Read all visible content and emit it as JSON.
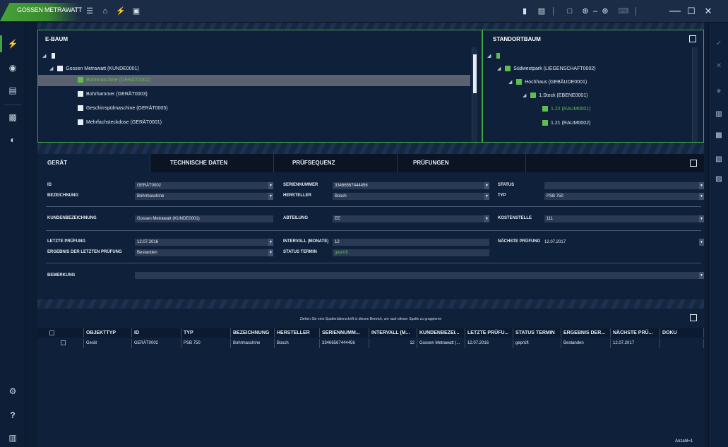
{
  "app": {
    "logo_text": "Gossen Metrawatt"
  },
  "titlebar": {
    "icons": [
      "menu-icon",
      "home-icon",
      "lightning-icon",
      "monitor-icon",
      "device-icon",
      "document-icon",
      "window-icon",
      "zoom-out-icon",
      "zoom-in-icon",
      "keyboard-icon"
    ],
    "zoom_separator": "–",
    "window_controls": [
      "minimize-icon",
      "maximize-icon",
      "close-icon"
    ]
  },
  "sidebar": {
    "top_icons": [
      "lightning-icon",
      "globe-icon",
      "chart-icon",
      "building-icon",
      "gauge-icon"
    ],
    "bottom_icons": [
      "settings-icon",
      "help-icon",
      "trash-icon"
    ],
    "help_glyph": "?"
  },
  "rightbar": {
    "icons": [
      "check-icon",
      "cancel-icon",
      "star-icon",
      "delete-icon",
      "copy-icon",
      "paste-icon",
      "export-icon"
    ]
  },
  "ebaum": {
    "title": "E-Baum",
    "rows": [
      {
        "label": "Gossen Metrawatt (KUNDE0001)",
        "level": 1
      },
      {
        "label": "Bohrmaschine (GERÄT0002)",
        "level": 2,
        "selected": true
      },
      {
        "label": "Bohrhammer (GERÄT0003)",
        "level": 2
      },
      {
        "label": "Geschirrspülmaschine (GERÄT0005)",
        "level": 2
      },
      {
        "label": "Mehrfachsteckdose (GERÄT0001)",
        "level": 2
      }
    ]
  },
  "standort": {
    "title": "Standortbaum",
    "rows": [
      {
        "label": "Südwestpark (LIEGENSCHAFT0002)",
        "level": 1
      },
      {
        "label": "Hochhaus (GEBÄUDE0001)",
        "level": 2
      },
      {
        "label": "1.Stock (EBENE0001)",
        "level": 3
      },
      {
        "label": "1.22 (RAUM0001)",
        "level": 4,
        "selected": true
      },
      {
        "label": "1.21 (RAUM0002)",
        "level": 4
      }
    ]
  },
  "tabs": [
    "Gerät",
    "Technische Daten",
    "Prüfsequenz",
    "Prüfungen"
  ],
  "form": {
    "id_label": "ID",
    "id_value": "GERÄT0002",
    "bezeichnung_label": "Bezeichnung",
    "bezeichnung_value": "Bohrmaschine",
    "seriennummer_label": "Seriennummer",
    "seriennummer_value": "33466567444456",
    "hersteller_label": "Hersteller",
    "hersteller_value": "Bosch",
    "status_label": "Status",
    "status_value": "",
    "typ_label": "Typ",
    "typ_value": "PSB 750",
    "kundenbez_label": "Kundenbezeichnung",
    "kundenbez_value": "Gossen Metrawatt (KUNDE0001)",
    "abteilung_label": "Abteilung",
    "abteilung_value": "EE",
    "kostenstelle_label": "Kostenstelle",
    "kostenstelle_value": "111",
    "letzte_label": "Letzte Prüfung",
    "letzte_value": "12.07.2016",
    "intervall_label": "Intervall (Monate)",
    "intervall_value": "12",
    "naechste_label": "Nächste Prüfung",
    "naechste_value": "12.07.2017",
    "ergebnis_label": "Ergebnis der letzten Prüfung",
    "ergebnis_value": "Bestanden",
    "statustermin_label": "Status Termin",
    "statustermin_value": "geprüft",
    "bemerkung_label": "Bemerkung",
    "bemerkung_value": ""
  },
  "grid": {
    "hint": "Ziehen Sie eine Spaltenüberschrift in diesen Bereich, um nach dieser Spalte zu gruppieren",
    "columns": [
      "Objekttyp",
      "ID",
      "Typ",
      "Bezeichnung",
      "Hersteller",
      "Seriennumm...",
      "Intervall (M...",
      "Kundenbezei...",
      "Letzte Prüfu...",
      "Status Termin",
      "Ergebnis der...",
      "Nächste Prü...",
      "Doku"
    ],
    "rows": [
      [
        "Gerät",
        "GERÄT0002",
        "PSB 750",
        "Bohrmaschine",
        "Bosch",
        "33466567444456",
        "12",
        "Gossen Metrawatt (...",
        "12.07.2016",
        "geprüft",
        "Bestanden",
        "12.07.2017",
        ""
      ]
    ],
    "count": "Anzahl=1"
  },
  "colors": {
    "accent": "#3fa640",
    "background": "#0c1c33",
    "panel": "#0f203a",
    "selection": "#5a6271"
  }
}
